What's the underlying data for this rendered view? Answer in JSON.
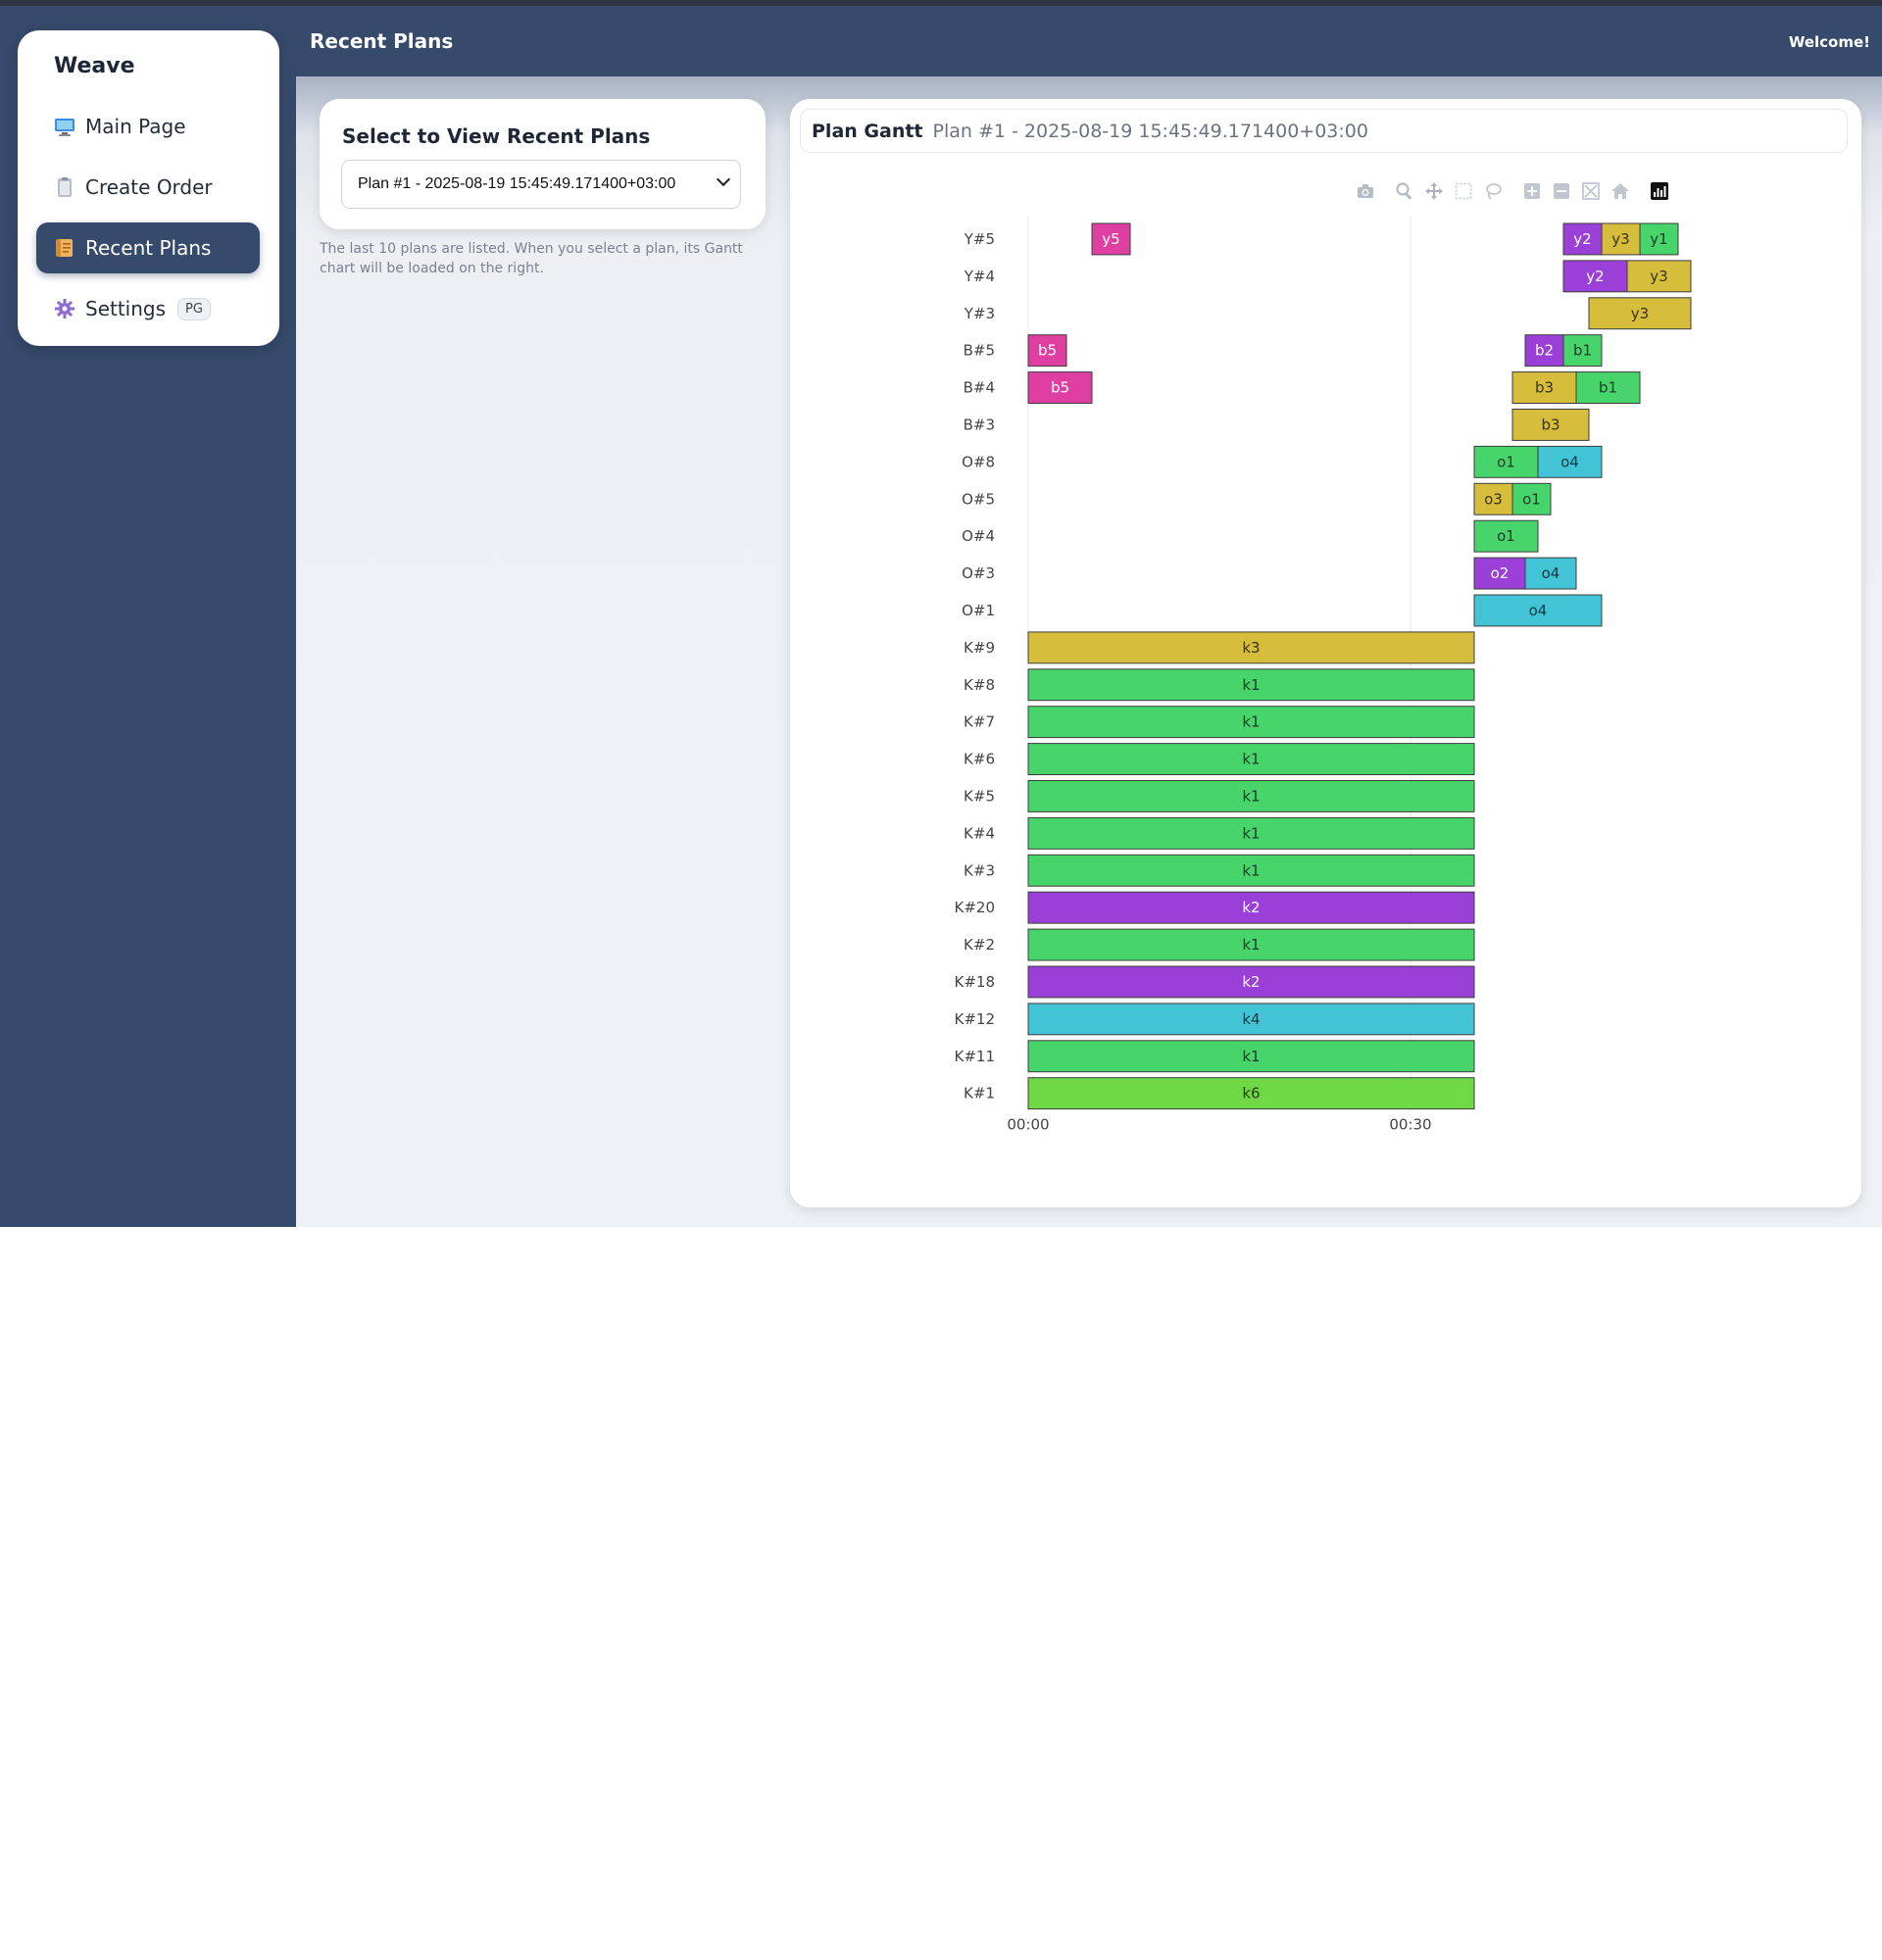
{
  "app": {
    "brand": "Weave",
    "header_title": "Recent Plans",
    "welcome": "Welcome!"
  },
  "sidebar": {
    "items": [
      {
        "label": "Main Page",
        "icon": "monitor-icon",
        "active": false
      },
      {
        "label": "Create Order",
        "icon": "clipboard-icon",
        "active": false
      },
      {
        "label": "Recent Plans",
        "icon": "scroll-icon",
        "active": true
      },
      {
        "label": "Settings",
        "icon": "gear-icon",
        "active": false,
        "badge": "PG"
      }
    ]
  },
  "select_panel": {
    "title": "Select to View Recent Plans",
    "selected": "Plan #1 - 2025-08-19 15:45:49.171400+03:00",
    "help": "The last 10 plans are listed. When you select a plan, its Gantt chart will be loaded on the right."
  },
  "gantt_panel": {
    "title": "Plan Gantt",
    "subtitle": "Plan #1 - 2025-08-19 15:45:49.171400+03:00",
    "modebar": [
      "camera-icon",
      "zoom-icon",
      "pan-icon",
      "box-select-icon",
      "lasso-icon",
      "zoom-in-icon",
      "zoom-out-icon",
      "autoscale-icon",
      "home-icon",
      "plotly-logo-icon"
    ]
  },
  "colors": {
    "green": "#46d46b",
    "purple": "#9a3fd8",
    "gold": "#d6bd3c",
    "cyan": "#42c4d6",
    "magenta": "#de3fa0",
    "lime": "#6fd845",
    "sidebar_bg": "#364a6b"
  },
  "chart_data": {
    "type": "gantt",
    "x_unit": "minutes",
    "xlim": [
      0,
      53
    ],
    "x_ticks": [
      {
        "value": 0,
        "label": "00:00"
      },
      {
        "value": 30,
        "label": "00:30"
      }
    ],
    "grid": true,
    "categories": [
      "Y#5",
      "Y#4",
      "Y#3",
      "B#5",
      "B#4",
      "B#3",
      "O#8",
      "O#5",
      "O#4",
      "O#3",
      "O#1",
      "K#9",
      "K#8",
      "K#7",
      "K#6",
      "K#5",
      "K#4",
      "K#3",
      "K#20",
      "K#2",
      "K#18",
      "K#12",
      "K#11",
      "K#1"
    ],
    "tasks": [
      {
        "row": "Y#5",
        "label": "y5",
        "start": 5,
        "end": 8,
        "color": "magenta"
      },
      {
        "row": "Y#5",
        "label": "y2",
        "start": 42,
        "end": 45,
        "color": "purple"
      },
      {
        "row": "Y#5",
        "label": "y3",
        "start": 45,
        "end": 48,
        "color": "gold"
      },
      {
        "row": "Y#5",
        "label": "y1",
        "start": 48,
        "end": 51,
        "color": "green"
      },
      {
        "row": "Y#4",
        "label": "y2",
        "start": 42,
        "end": 47,
        "color": "purple"
      },
      {
        "row": "Y#4",
        "label": "y3",
        "start": 47,
        "end": 52,
        "color": "gold"
      },
      {
        "row": "Y#3",
        "label": "y3",
        "start": 44,
        "end": 52,
        "color": "gold"
      },
      {
        "row": "B#5",
        "label": "b5",
        "start": 0,
        "end": 3,
        "color": "magenta"
      },
      {
        "row": "B#5",
        "label": "b2",
        "start": 39,
        "end": 42,
        "color": "purple"
      },
      {
        "row": "B#5",
        "label": "b1",
        "start": 42,
        "end": 45,
        "color": "green"
      },
      {
        "row": "B#4",
        "label": "b5",
        "start": 0,
        "end": 5,
        "color": "magenta"
      },
      {
        "row": "B#4",
        "label": "b3",
        "start": 38,
        "end": 43,
        "color": "gold"
      },
      {
        "row": "B#4",
        "label": "b1",
        "start": 43,
        "end": 48,
        "color": "green"
      },
      {
        "row": "B#3",
        "label": "b3",
        "start": 38,
        "end": 44,
        "color": "gold"
      },
      {
        "row": "O#8",
        "label": "o1",
        "start": 35,
        "end": 40,
        "color": "green"
      },
      {
        "row": "O#8",
        "label": "o4",
        "start": 40,
        "end": 45,
        "color": "cyan"
      },
      {
        "row": "O#5",
        "label": "o3",
        "start": 35,
        "end": 38,
        "color": "gold"
      },
      {
        "row": "O#5",
        "label": "o1",
        "start": 38,
        "end": 41,
        "color": "green"
      },
      {
        "row": "O#4",
        "label": "o1",
        "start": 35,
        "end": 40,
        "color": "green"
      },
      {
        "row": "O#3",
        "label": "o2",
        "start": 35,
        "end": 39,
        "color": "purple"
      },
      {
        "row": "O#3",
        "label": "o4",
        "start": 39,
        "end": 43,
        "color": "cyan"
      },
      {
        "row": "O#1",
        "label": "o4",
        "start": 35,
        "end": 45,
        "color": "cyan"
      },
      {
        "row": "K#9",
        "label": "k3",
        "start": 0,
        "end": 35,
        "color": "gold"
      },
      {
        "row": "K#8",
        "label": "k1",
        "start": 0,
        "end": 35,
        "color": "green"
      },
      {
        "row": "K#7",
        "label": "k1",
        "start": 0,
        "end": 35,
        "color": "green"
      },
      {
        "row": "K#6",
        "label": "k1",
        "start": 0,
        "end": 35,
        "color": "green"
      },
      {
        "row": "K#5",
        "label": "k1",
        "start": 0,
        "end": 35,
        "color": "green"
      },
      {
        "row": "K#4",
        "label": "k1",
        "start": 0,
        "end": 35,
        "color": "green"
      },
      {
        "row": "K#3",
        "label": "k1",
        "start": 0,
        "end": 35,
        "color": "green"
      },
      {
        "row": "K#20",
        "label": "k2",
        "start": 0,
        "end": 35,
        "color": "purple"
      },
      {
        "row": "K#2",
        "label": "k1",
        "start": 0,
        "end": 35,
        "color": "green"
      },
      {
        "row": "K#18",
        "label": "k2",
        "start": 0,
        "end": 35,
        "color": "purple"
      },
      {
        "row": "K#12",
        "label": "k4",
        "start": 0,
        "end": 35,
        "color": "cyan"
      },
      {
        "row": "K#11",
        "label": "k1",
        "start": 0,
        "end": 35,
        "color": "green"
      },
      {
        "row": "K#1",
        "label": "k6",
        "start": 0,
        "end": 35,
        "color": "lime"
      }
    ]
  }
}
